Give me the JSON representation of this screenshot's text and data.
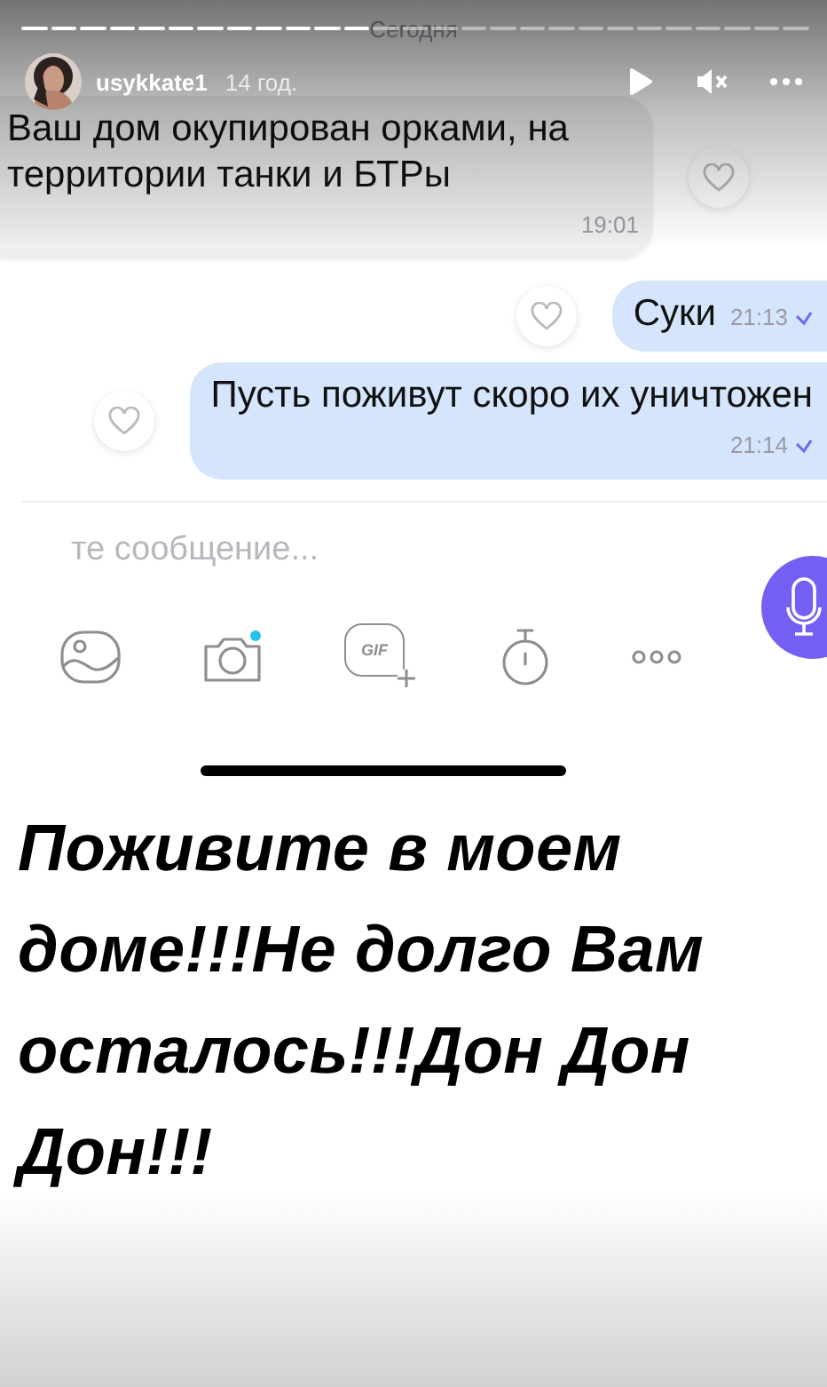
{
  "story": {
    "segments": [
      {
        "viewed": true
      },
      {
        "viewed": true
      },
      {
        "viewed": true
      },
      {
        "viewed": true
      },
      {
        "viewed": true
      },
      {
        "viewed": true
      },
      {
        "viewed": true
      },
      {
        "viewed": true
      },
      {
        "viewed": true
      },
      {
        "viewed": true
      },
      {
        "viewed": true
      },
      {
        "viewed": true
      },
      {
        "viewed": false
      },
      {
        "viewed": false
      },
      {
        "viewed": false
      },
      {
        "viewed": false
      },
      {
        "viewed": false
      },
      {
        "viewed": false
      },
      {
        "viewed": false
      },
      {
        "viewed": false
      },
      {
        "viewed": false
      },
      {
        "viewed": false
      },
      {
        "viewed": false
      },
      {
        "viewed": false
      },
      {
        "viewed": false
      },
      {
        "viewed": false
      },
      {
        "viewed": false
      }
    ],
    "username": "usykkate1",
    "time": "14 год.",
    "muted": true
  },
  "chat": {
    "date_separator": "Сегодня",
    "messages": [
      {
        "kind": "incoming",
        "text": "Ваш дом окупирован орками, на территории танки и  БТРы",
        "time": "19:01",
        "read": false
      },
      {
        "kind": "outgoing",
        "text": "Суки",
        "time": "21:13",
        "read": true
      },
      {
        "kind": "outgoing",
        "text": "Пусть поживут скоро их уничтожен",
        "time": "21:14",
        "read": true
      }
    ],
    "composer": {
      "placeholder": "те сообщение...",
      "gif_label": "GIF",
      "camera_badge": true
    }
  },
  "caption": "Поживите в моем доме!!!Не долго Вам осталось!!!Дон Дон Дон!!!"
}
